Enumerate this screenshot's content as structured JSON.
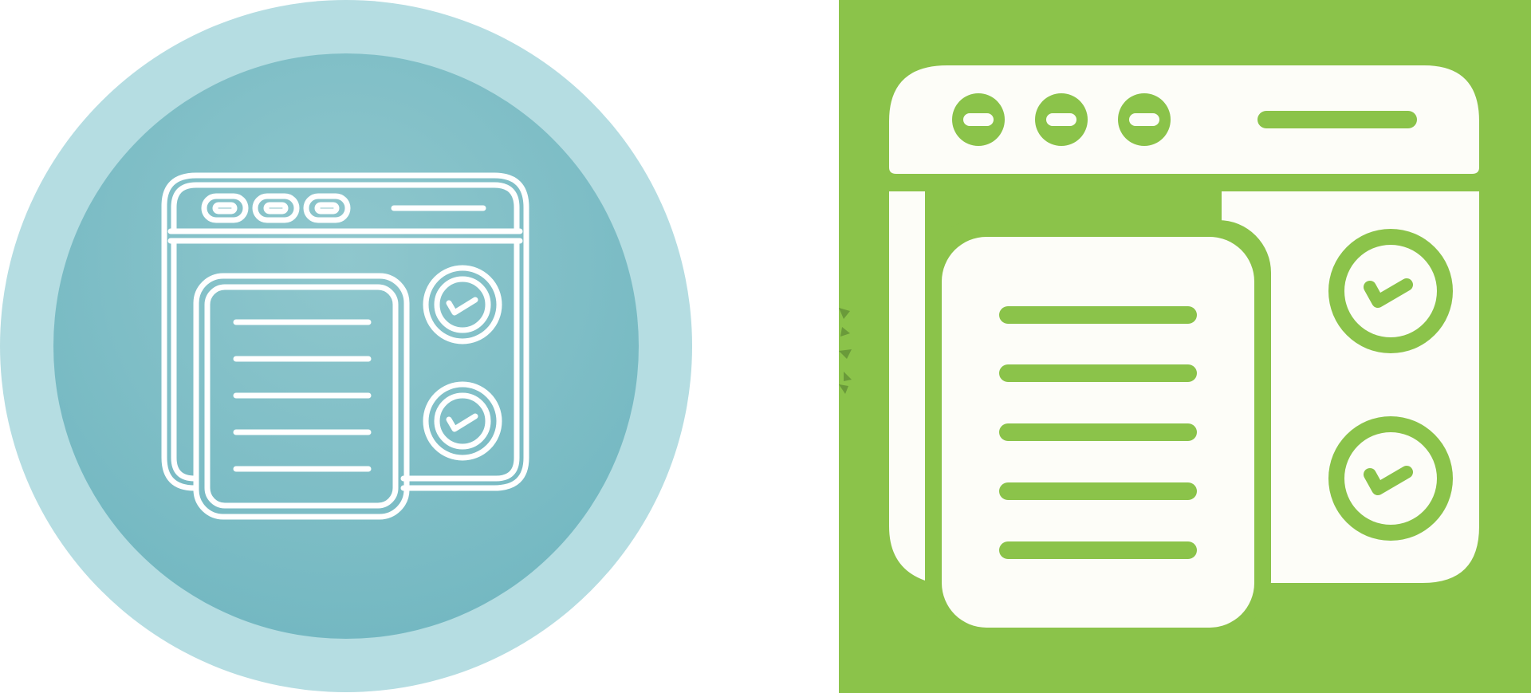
{
  "icons": [
    {
      "name": "browser-checklist-icon",
      "style": "outline",
      "colors": {
        "outer_circle": "#b5dde2",
        "inner_circle_light": "#8fc7cd",
        "inner_circle_dark": "#72b7c1",
        "stroke": "#ffffff"
      }
    },
    {
      "name": "browser-checklist-icon",
      "style": "glyph",
      "colors": {
        "background": "#8bc34a",
        "fill": "#fdfdf8",
        "accent": "#8bc34a"
      }
    }
  ]
}
